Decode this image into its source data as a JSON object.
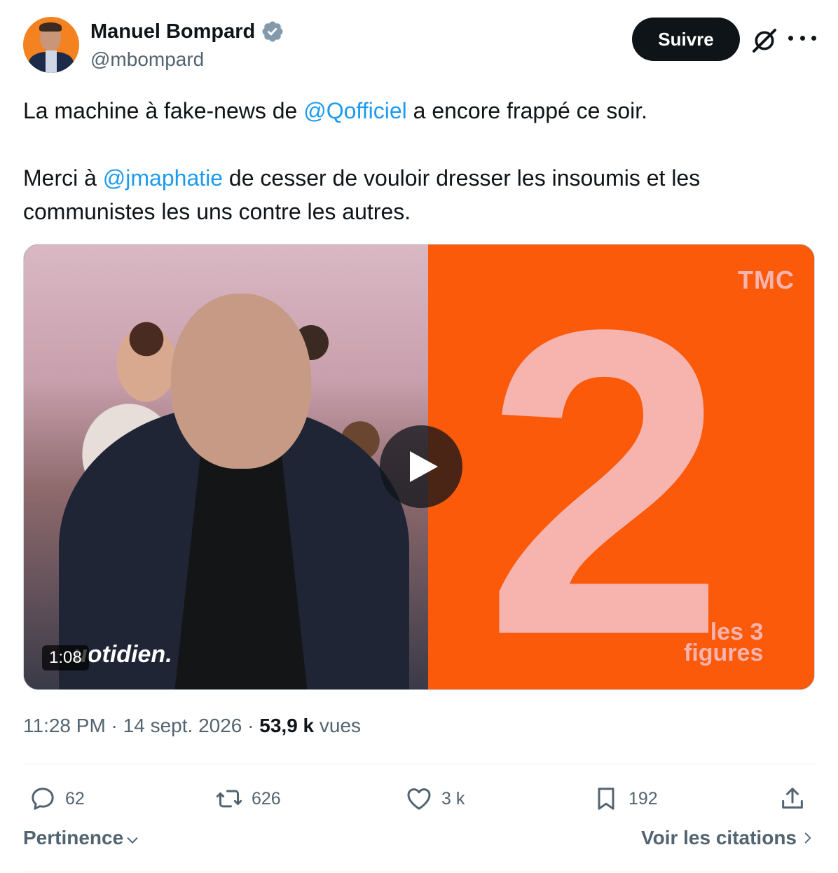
{
  "author": {
    "name": "Manuel Bompard",
    "handle": "@mbompard",
    "verified": true,
    "avatar_icon": "avatar-photo"
  },
  "header": {
    "follow_label": "Suivre",
    "grok_icon": "grok-icon",
    "more_icon": "more-icon"
  },
  "tweet": {
    "line1_before": "La machine à fake-news de ",
    "line1_mention": "@Qofficiel",
    "line1_after": " a encore frappé ce soir.",
    "line2_before": "Merci à ",
    "line2_mention": "@jmaphatie",
    "line2_after": " de cesser de vouloir dresser les insoumis et les communistes les uns contre les autres."
  },
  "media": {
    "duration": "1:08",
    "left_logo": "uotidien.",
    "channel_logo": "TMC",
    "big_number": "2",
    "show_logo_line1": "les 3",
    "show_logo_line2": "figures",
    "play_icon": "play-icon"
  },
  "meta": {
    "time": "11:28 PM",
    "separator": " · ",
    "date": "14 sept. 2026",
    "views_count": "53,9 k",
    "views_label": " vues"
  },
  "actions": {
    "replies": "62",
    "reposts": "626",
    "likes": "3 k",
    "bookmarks": "192"
  },
  "footer": {
    "sort_label": "Pertinence",
    "quotes_label": "Voir les citations"
  },
  "colors": {
    "accent": "#1d9bf0",
    "text": "#0f1419",
    "secondary": "#536471",
    "tmc_orange": "#fb5a0b",
    "two_pink": "#f7b3ad"
  }
}
